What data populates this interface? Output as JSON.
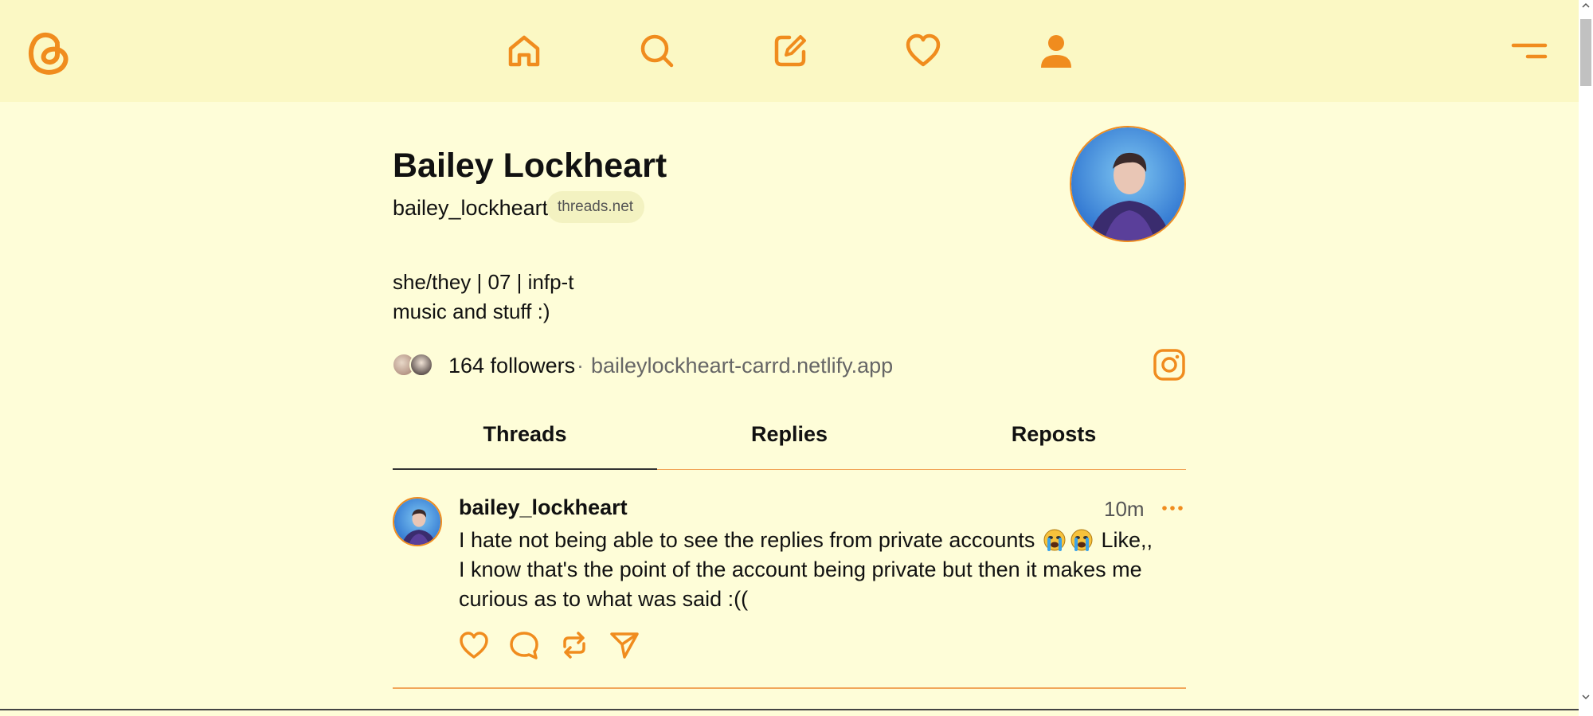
{
  "theme": {
    "accent": "#f08c1e",
    "header_bg": "#fbf8c4",
    "page_bg": "#fefdd8"
  },
  "header": {
    "logo_icon": "threads-logo-icon",
    "nav": [
      "home-icon",
      "search-icon",
      "compose-icon",
      "heart-icon",
      "profile-icon"
    ],
    "menu_icon": "menu-icon"
  },
  "profile": {
    "name": "Bailey Lockheart",
    "handle": "bailey_lockheart",
    "domain": "threads.net",
    "bio_line1": "she/they | 07 | infp-t",
    "bio_line2": "music and stuff :)",
    "followers": "164 followers",
    "separator": "·",
    "link": "baileylockheart-carrd.netlify.app"
  },
  "tabs": [
    {
      "label": "Threads",
      "active": true
    },
    {
      "label": "Replies",
      "active": false
    },
    {
      "label": "Reposts",
      "active": false
    }
  ],
  "post": {
    "username": "bailey_lockheart",
    "time": "10m",
    "text_part1": "I hate not being able to see the replies from private accounts",
    "text_part2": "Like,, I know that's the point of the account being private but then it makes me curious as to what was said :(("
  }
}
